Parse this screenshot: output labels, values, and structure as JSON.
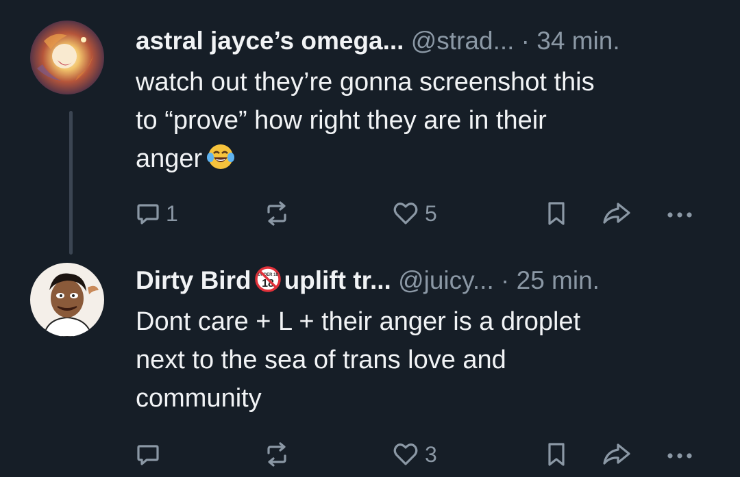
{
  "posts": [
    {
      "display_name": "astral jayce’s omega...",
      "handle": "@strad...",
      "time": " · 34 min.",
      "avatar": "cosmic-painting-avatar",
      "body_lines": [
        "watch out they’re gonna screenshot this",
        "to “prove” how right they are in their",
        "anger"
      ],
      "emoji": "face-with-tears-of-joy",
      "reply_count": "1",
      "repost_count": "",
      "like_count": "5"
    },
    {
      "display_name_part1": "Dirty Bird",
      "badge": "UNDER 18",
      "badge_label": "18",
      "display_name_part2": "uplift tr...",
      "handle": "@juicy...",
      "time": " · 25 min.",
      "avatar": "cartoon-man-avatar",
      "body_lines": [
        "Dont care + L + their anger is a droplet",
        "next to the sea of trans love and",
        "community"
      ],
      "reply_count": "",
      "repost_count": "",
      "like_count": "3"
    }
  ],
  "icons": {
    "reply": "speech-bubble-icon",
    "repost": "repost-arrows-icon",
    "like": "heart-icon",
    "bookmark": "bookmark-icon",
    "share": "share-arrow-icon",
    "more": "ellipsis-icon"
  },
  "colors": {
    "background": "#161e27",
    "primary_text": "#f1f3f5",
    "secondary_text": "#8b98a5",
    "thread_line": "#3b4552",
    "badge_red": "#e0313a"
  }
}
